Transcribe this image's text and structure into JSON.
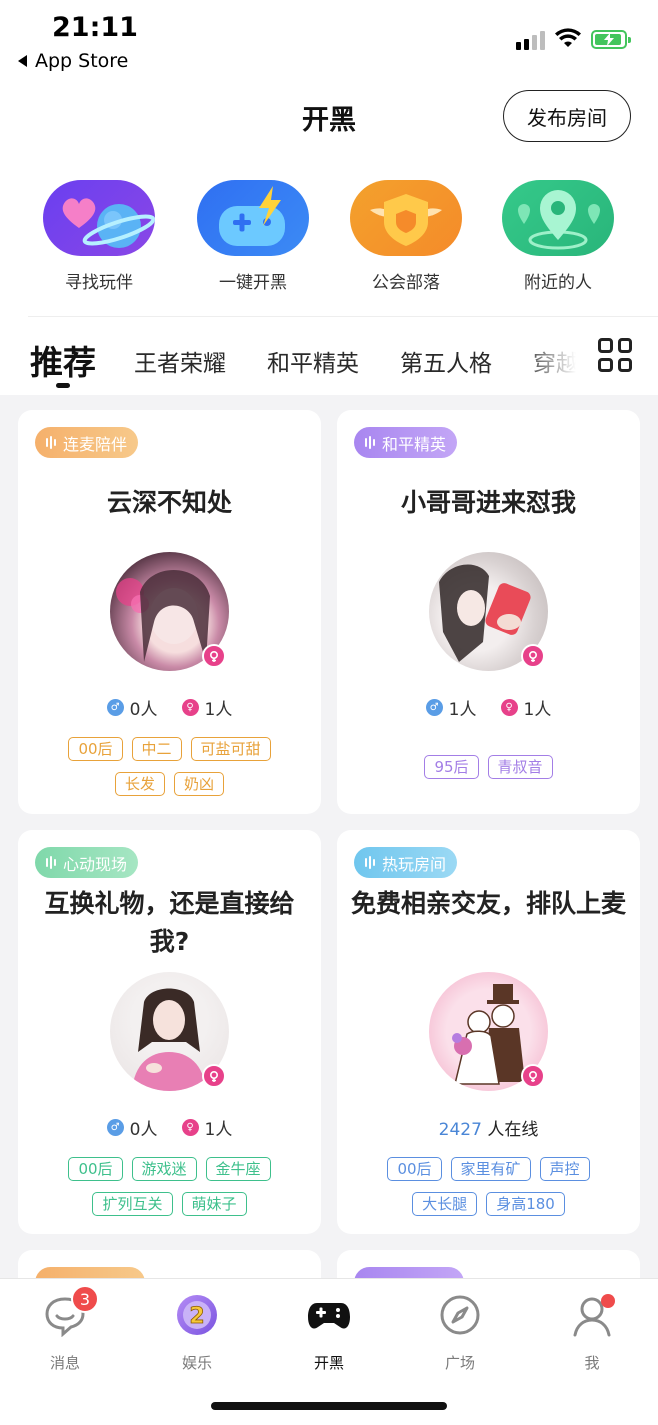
{
  "status_bar": {
    "time": "21:11",
    "back_app": "App Store"
  },
  "header": {
    "title": "开黑",
    "publish_button": "发布房间"
  },
  "quick_actions": [
    {
      "label": "寻找玩伴",
      "icon": "heart-planet-icon"
    },
    {
      "label": "一键开黑",
      "icon": "gamepad-lightning-icon"
    },
    {
      "label": "公会部落",
      "icon": "winged-shield-icon"
    },
    {
      "label": "附近的人",
      "icon": "location-pin-icon"
    }
  ],
  "tabs": [
    {
      "label": "推荐",
      "active": true
    },
    {
      "label": "王者荣耀"
    },
    {
      "label": "和平精英"
    },
    {
      "label": "第五人格"
    },
    {
      "label": "穿越"
    }
  ],
  "cards": [
    {
      "tag": "连麦陪伴",
      "tag_colors": [
        "#f5b06b",
        "#f7c98a"
      ],
      "title": "云深不知处",
      "male_count": "0人",
      "female_count": "1人",
      "labels": [
        "00后",
        "中二",
        "可盐可甜",
        "长发",
        "奶凶"
      ],
      "label_color": "#e8a23a"
    },
    {
      "tag": "和平精英",
      "tag_colors": [
        "#a886f0",
        "#c3a6f6"
      ],
      "title": "小哥哥进来怼我",
      "male_count": "1人",
      "female_count": "1人",
      "labels": [
        "95后",
        "青叔音"
      ],
      "label_color": "#a37ee6"
    },
    {
      "tag": "心动现场",
      "tag_colors": [
        "#7fd8aa",
        "#a6e6c3"
      ],
      "title": "互换礼物，还是直接给我?",
      "male_count": "0人",
      "female_count": "1人",
      "labels": [
        "00后",
        "游戏迷",
        "金牛座",
        "扩列互关",
        "萌妹子"
      ],
      "label_color": "#3ec08c"
    },
    {
      "tag": "热玩房间",
      "tag_colors": [
        "#6fc6ee",
        "#9bd9f4"
      ],
      "title": "免费相亲交友，排队上麦",
      "online_number": "2427",
      "online_suffix": "人在线",
      "labels": [
        "00后",
        "家里有矿",
        "声控",
        "大长腿",
        "身高180"
      ],
      "label_color": "#5b8fe0"
    }
  ],
  "tabbar": [
    {
      "label": "消息",
      "icon": "chat-bubble-icon",
      "badge": "3"
    },
    {
      "label": "娱乐",
      "icon": "entertainment-icon"
    },
    {
      "label": "开黑",
      "icon": "gamepad-icon",
      "active": true
    },
    {
      "label": "广场",
      "icon": "compass-icon"
    },
    {
      "label": "我",
      "icon": "profile-icon",
      "dot": true
    }
  ]
}
